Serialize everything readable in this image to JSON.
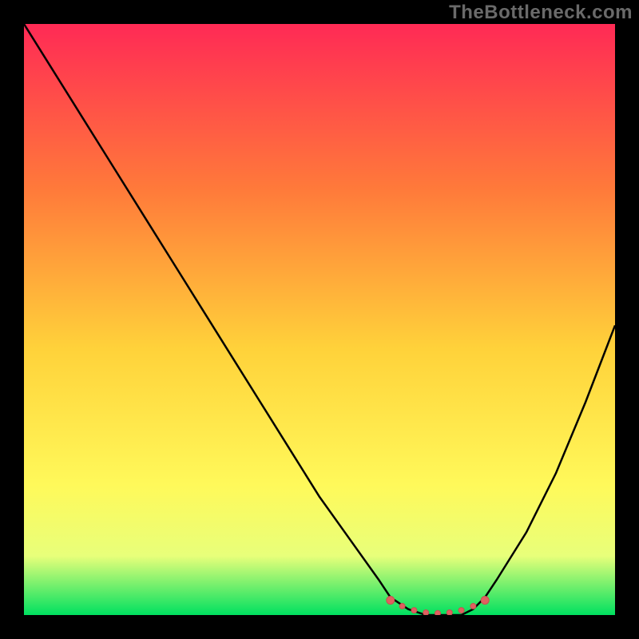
{
  "watermark": "TheBottleneck.com",
  "colors": {
    "background": "#000000",
    "gradient_top": "#ff2a55",
    "gradient_mid1": "#ff7a3a",
    "gradient_mid2": "#ffd23a",
    "gradient_mid3": "#fff95a",
    "gradient_mid4": "#e8ff7a",
    "gradient_bottom": "#00e060",
    "curve": "#000000",
    "marker_fill": "#e06060",
    "marker_stroke": "#c85050"
  },
  "chart_data": {
    "type": "line",
    "title": "",
    "xlabel": "",
    "ylabel": "",
    "xlim": [
      0,
      100
    ],
    "ylim": [
      0,
      100
    ],
    "series": [
      {
        "name": "bottleneck-curve",
        "x": [
          0,
          5,
          10,
          15,
          20,
          25,
          30,
          35,
          40,
          45,
          50,
          55,
          60,
          62,
          65,
          68,
          70,
          72,
          74,
          76,
          78,
          80,
          85,
          90,
          95,
          100
        ],
        "y": [
          100,
          92,
          84,
          76,
          68,
          60,
          52,
          44,
          36,
          28,
          20,
          13,
          6,
          3,
          1,
          0,
          0,
          0,
          0,
          1,
          3,
          6,
          14,
          24,
          36,
          49
        ]
      }
    ],
    "markers": {
      "name": "sweet-spot",
      "x": [
        62,
        64,
        66,
        68,
        70,
        72,
        74,
        76,
        78
      ],
      "y": [
        2.5,
        1.5,
        0.8,
        0.4,
        0.3,
        0.4,
        0.8,
        1.5,
        2.5
      ]
    },
    "annotations": []
  }
}
